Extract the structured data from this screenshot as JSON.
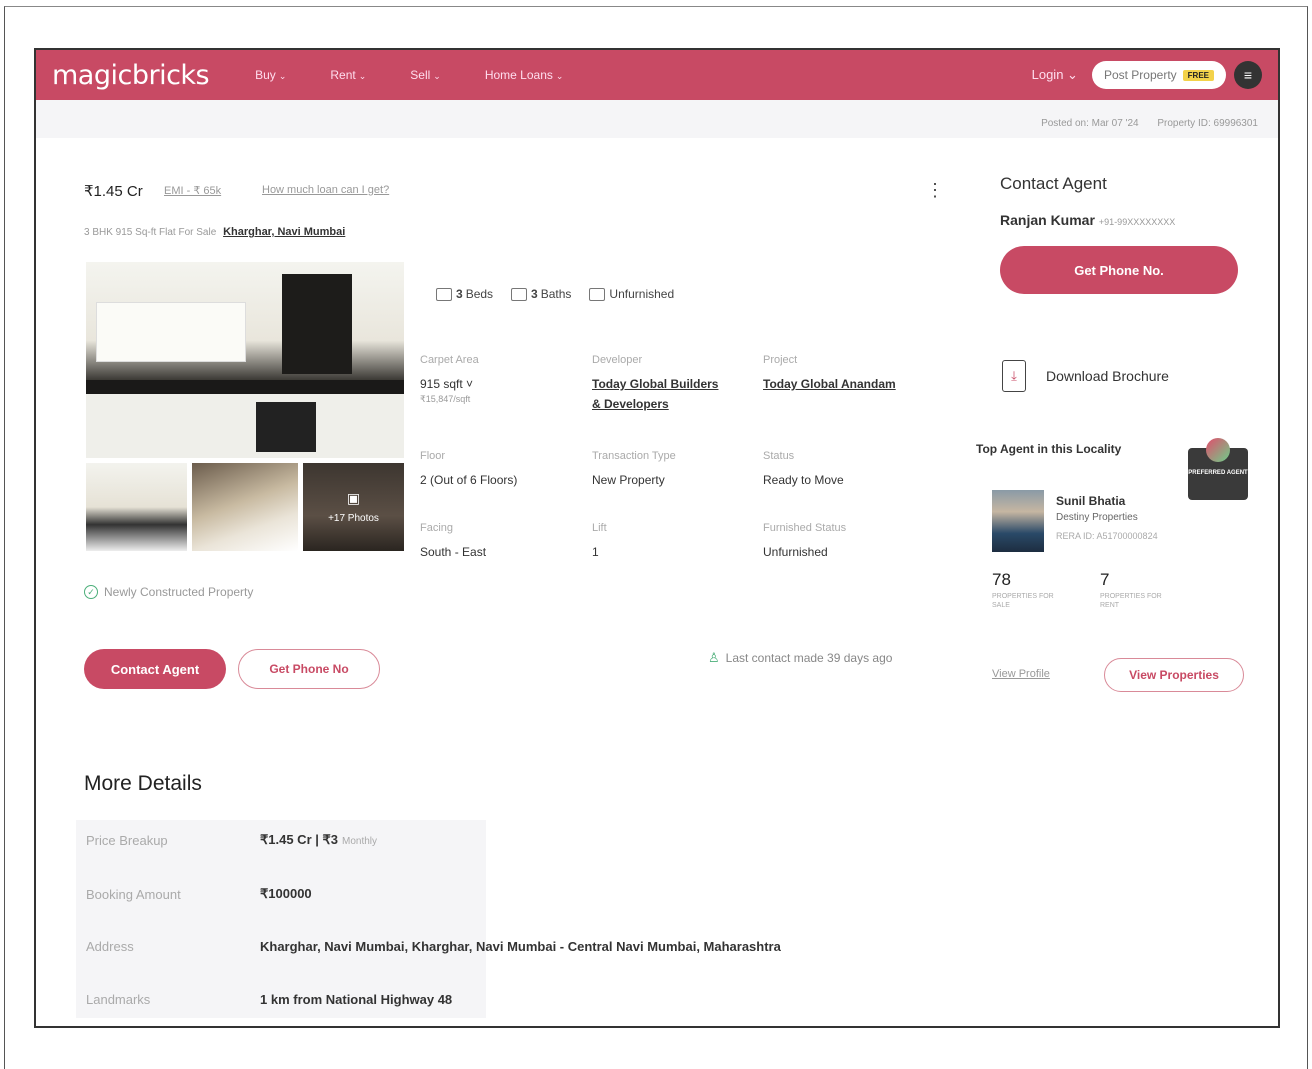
{
  "header": {
    "logo": "magicbricks",
    "nav": [
      "Buy",
      "Rent",
      "Sell",
      "Home Loans"
    ],
    "login": "Login",
    "post_property": "Post Property",
    "free_badge": "FREE"
  },
  "meta": {
    "posted_on": "Posted on: Mar 07 '24",
    "property_id": "Property ID: 69996301"
  },
  "listing": {
    "price": "₹1.45 Cr",
    "emi": "EMI - ₹ 65k",
    "loan_link": "How much loan can I get?",
    "title": "3 BHK 915 Sq-ft Flat For Sale",
    "locality": "Kharghar, Navi Mumbai",
    "photos_more": "+17 Photos",
    "amenities": {
      "beds_count": "3",
      "beds_label": "Beds",
      "baths_count": "3",
      "baths_label": "Baths",
      "furnishing": "Unfurnished"
    },
    "specs": {
      "carpet_area_label": "Carpet Area",
      "carpet_area": "915 sqft",
      "carpet_rate": "₹15,847/sqft",
      "developer_label": "Developer",
      "developer_line1": "Today Global Builders",
      "developer_line2": "& Developers",
      "project_label": "Project",
      "project": "Today Global Anandam",
      "floor_label": "Floor",
      "floor": "2 (Out of 6 Floors)",
      "transaction_label": "Transaction Type",
      "transaction": "New Property",
      "status_label": "Status",
      "status": "Ready to Move",
      "facing_label": "Facing",
      "facing": "South - East",
      "lift_label": "Lift",
      "lift": "1",
      "furnished_label": "Furnished Status",
      "furnished": "Unfurnished"
    },
    "newly_constructed": "Newly Constructed Property",
    "contact_agent_btn": "Contact Agent",
    "get_phone_btn": "Get Phone No",
    "last_contact": "Last contact made 39 days ago"
  },
  "agent_panel": {
    "title": "Contact Agent",
    "agent_name": "Ranjan Kumar",
    "agent_phone": "+91-99XXXXXXXX",
    "get_phone_btn": "Get Phone No.",
    "download_brochure": "Download Brochure",
    "top_agent_heading": "Top Agent in this Locality",
    "preferred_badge": "PREFERRED AGENT",
    "top_agent": {
      "name": "Sunil Bhatia",
      "company": "Destiny Properties",
      "rera": "RERA ID: A51700000824",
      "for_sale_count": "78",
      "for_sale_label": "PROPERTIES FOR SALE",
      "for_rent_count": "7",
      "for_rent_label": "PROPERTIES FOR RENT"
    },
    "view_profile": "View Profile",
    "view_properties": "View Properties"
  },
  "more_details": {
    "title": "More Details",
    "price_breakup_label": "Price Breakup",
    "price_breakup": "₹1.45 Cr | ₹3",
    "price_breakup_note": "Monthly",
    "booking_label": "Booking Amount",
    "booking": "₹100000",
    "address_label": "Address",
    "address": "Kharghar, Navi Mumbai, Kharghar, Navi Mumbai - Central Navi Mumbai, Maharashtra",
    "landmarks_label": "Landmarks",
    "landmarks": "1 km from National Highway 48"
  },
  "colors": {
    "brand": "#c84a64",
    "accent_green": "#4caf7a"
  }
}
